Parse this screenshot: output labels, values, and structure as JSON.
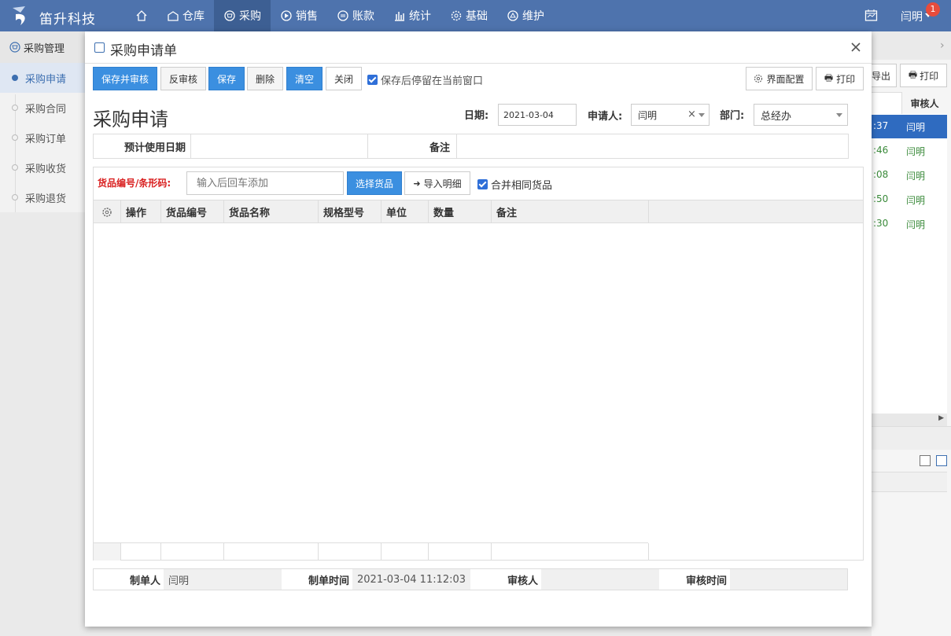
{
  "topbar": {
    "brand": "笛升科技",
    "nav": [
      {
        "label": "",
        "icon": "home-icon"
      },
      {
        "label": "仓库",
        "icon": "warehouse-icon"
      },
      {
        "label": "采购",
        "icon": "purchase-icon"
      },
      {
        "label": "销售",
        "icon": "sales-icon"
      },
      {
        "label": "账款",
        "icon": "account-icon"
      },
      {
        "label": "统计",
        "icon": "stats-icon"
      },
      {
        "label": "基础",
        "icon": "gear-icon"
      },
      {
        "label": "维护",
        "icon": "maintain-icon"
      }
    ],
    "user": "闫明",
    "badge": "1"
  },
  "sidebar": {
    "header": "采购管理",
    "items": [
      "采购申请",
      "采购合同",
      "采购订单",
      "采购收货",
      "采购退货"
    ]
  },
  "background": {
    "export_label": "导出",
    "print_label": "打印",
    "col_header": "审核人",
    "times": [
      ":37",
      ":46",
      ":08",
      ":50",
      ":30"
    ],
    "reviewers": [
      "闫明",
      "闫明",
      "闫明",
      "闫明",
      "闫明"
    ]
  },
  "modal": {
    "title": "采购申请单",
    "toolbar": {
      "save_approve": "保存并审核",
      "unapprove": "反审核",
      "save": "保存",
      "delete": "删除",
      "clear": "清空",
      "close": "关闭",
      "stay_label": "保存后停留在当前窗口",
      "config": "界面配置",
      "print": "打印"
    },
    "heading": "采购申请",
    "date_label": "日期:",
    "date_value": "2021-03-04",
    "applicant_label": "申请人:",
    "applicant_value": "闫明",
    "dept_label": "部门:",
    "dept_value": "总经办",
    "expected_date_label": "预计使用日期",
    "remark_label": "备注",
    "barcode_label": "货品编号/条形码:",
    "barcode_placeholder": "输入后回车添加",
    "select_goods": "选择货品",
    "import_detail": "导入明细",
    "merge_label": "合并相同货品",
    "columns": [
      "操作",
      "货品编号",
      "货品名称",
      "规格型号",
      "单位",
      "数量",
      "备注"
    ],
    "footer": {
      "creator_label": "制单人",
      "creator_value": "闫明",
      "created_time_label": "制单时间",
      "created_time_value": "2021-03-04 11:12:03",
      "reviewer_label": "审核人",
      "reviewer_value": "",
      "review_time_label": "审核时间",
      "review_time_value": ""
    }
  }
}
